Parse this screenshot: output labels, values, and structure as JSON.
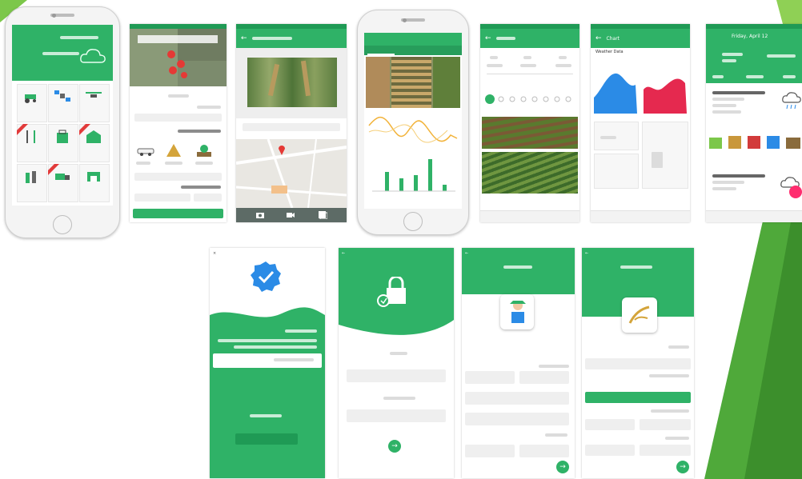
{
  "screen6": {
    "title": "Chart"
  },
  "screen7": {
    "title": "Chart",
    "section": "Weather Data"
  },
  "screen8": {
    "title": "Friday, April 12"
  },
  "colors": {
    "primary": "#2fb267",
    "dark": "#1f9a55",
    "accent": "#ff2d6f",
    "blue": "#2b8be6"
  }
}
